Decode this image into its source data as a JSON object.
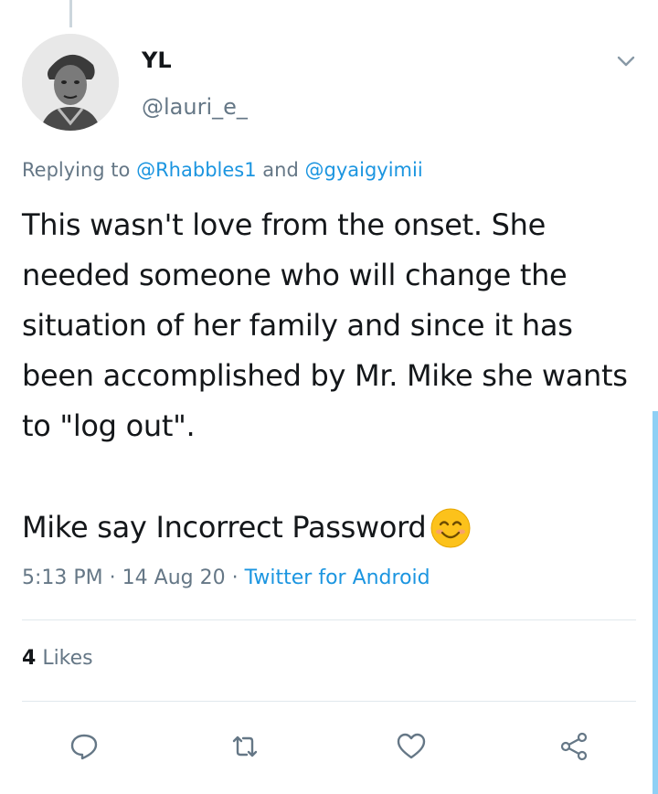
{
  "tweet": {
    "author": {
      "display_name": "YL",
      "handle": "@lauri_e_"
    },
    "reply": {
      "prefix": "Replying to",
      "mention_1": "@Rhabbles1",
      "joiner": "and",
      "mention_2": "@gyaigyimii"
    },
    "body_paragraph_1": "This wasn't love from the onset. She needed someone who will change the situation of her family and since it has been accomplished by Mr. Mike she wants to \"log out\".",
    "body_paragraph_2": "Mike say Incorrect Password",
    "emoji": "smiling-face-icon",
    "time": "5:13 PM",
    "sep_1": "·",
    "date": "14 Aug 20",
    "sep_2": "·",
    "source": "Twitter for Android",
    "likes_count": "4",
    "likes_label": "Likes"
  },
  "colors": {
    "link": "#1b95e0",
    "secondary_text": "#657786",
    "primary_text": "#14171a",
    "divider": "#e1e8ed"
  },
  "icons": {
    "header": "chevron-down-icon",
    "actions": [
      "reply-icon",
      "retweet-icon",
      "like-icon",
      "share-icon"
    ]
  }
}
